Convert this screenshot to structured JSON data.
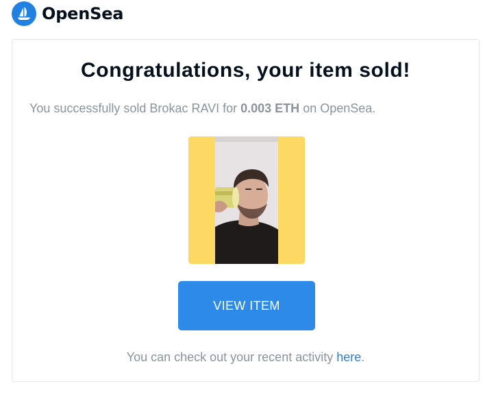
{
  "header": {
    "brand_name": "OpenSea",
    "logo_icon": "opensea-boat-icon"
  },
  "email": {
    "headline": "Congratulations, your item sold!",
    "message_prefix": "You successfully sold Brokac RAVI for ",
    "price": "0.003 ETH",
    "message_suffix": " on OpenSea.",
    "item_image": "nft-item-image",
    "view_button_label": "VIEW ITEM",
    "footer_prefix": "You can check out your recent activity ",
    "footer_link": "here",
    "footer_suffix": "."
  },
  "colors": {
    "brand_blue": "#2081e2",
    "button_blue": "#2d8ae8",
    "nft_background": "#fdd964",
    "muted_text": "#8a939b",
    "heading_text": "#04111d"
  }
}
